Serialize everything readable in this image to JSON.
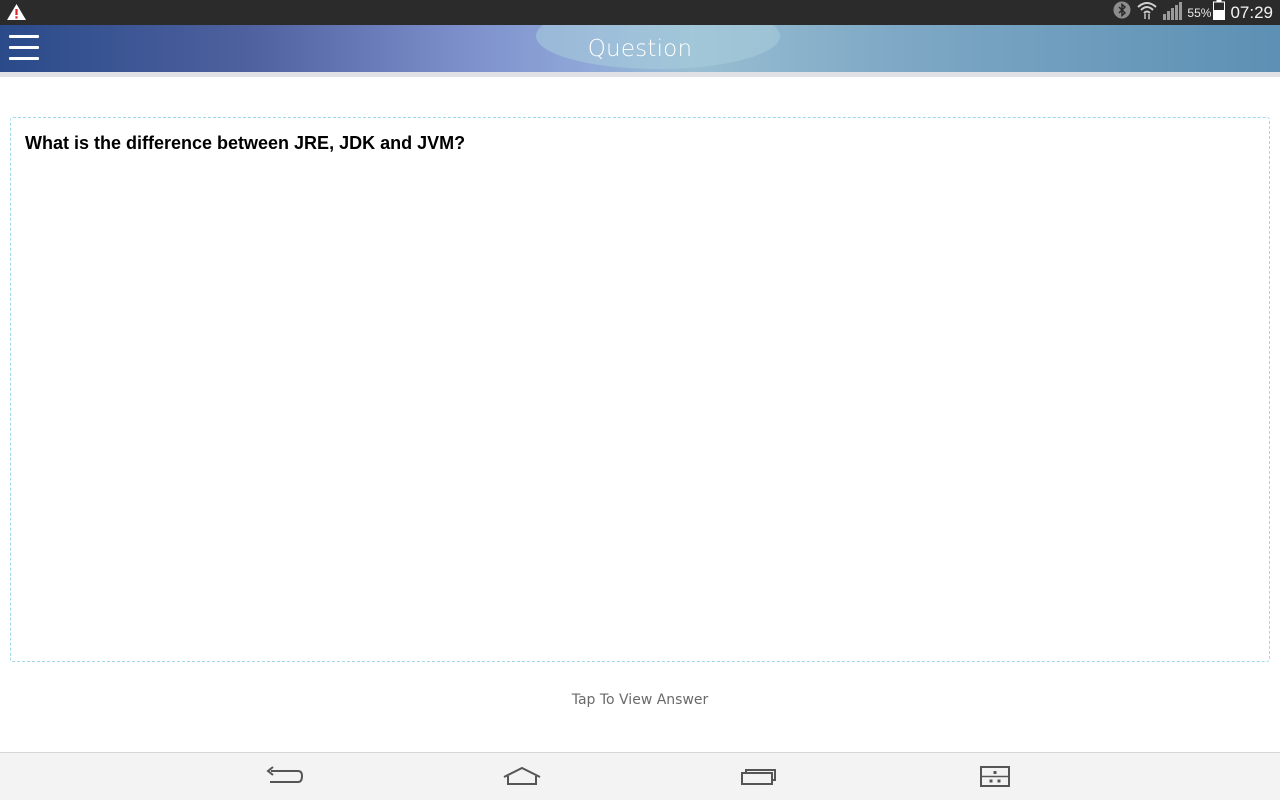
{
  "status_bar": {
    "warning_icon": "warning-triangle-icon",
    "bluetooth_icon": "bluetooth-icon",
    "wifi_icon": "wifi-icon",
    "signal_icon": "signal-icon",
    "battery_percent": "55%",
    "battery_icon": "battery-icon",
    "time": "07:29"
  },
  "app_bar": {
    "menu_icon": "hamburger-menu-icon",
    "title": "Question"
  },
  "question": {
    "text": "What is the difference between JRE, JDK and JVM?"
  },
  "footer": {
    "tap_label": "Tap To View Answer"
  },
  "nav_bar": {
    "back_icon": "back-icon",
    "home_icon": "home-icon",
    "recents_icon": "recent-apps-icon",
    "menu_icon": "screen-capture-icon"
  },
  "colors": {
    "status_bar_bg": "#2b2b2b",
    "app_bar_start": "#2a4a8a",
    "app_bar_end": "#5c90b4",
    "card_border": "#9fd9e8",
    "nav_bar_bg": "#f3f3f3"
  }
}
